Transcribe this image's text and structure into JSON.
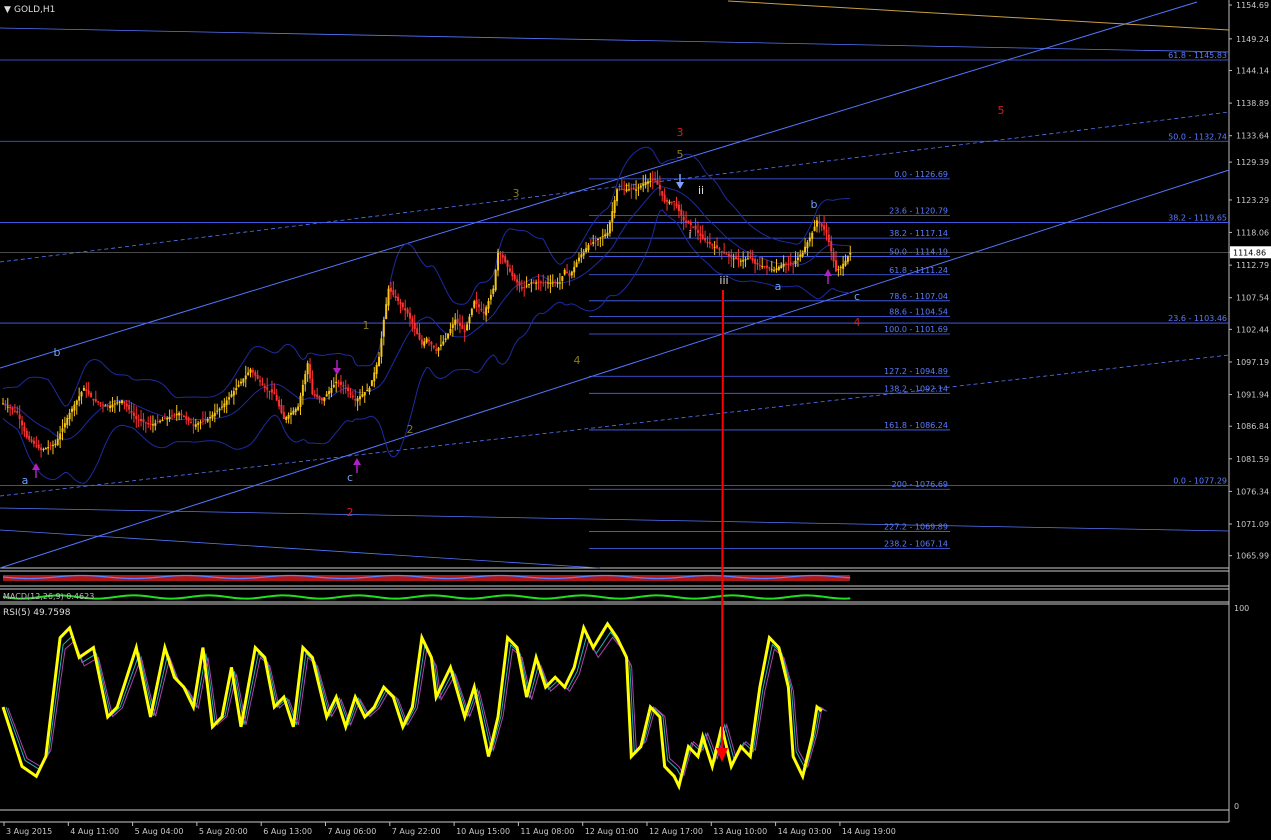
{
  "symbol_title": "GOLD,H1",
  "rsi_label": "RSI(5) 49.7598",
  "macd_label": "MACD(12,26,9) 0.4623",
  "colors": {
    "bull": "#f5c518",
    "bear": "#ff3030",
    "bands": "#1e2aa0",
    "fib": "#4a66ff",
    "channel": "#5577ff",
    "rsi": "#ffff00",
    "arrow": "#ff0000"
  },
  "chart_data": {
    "type": "candlestick",
    "ylim": [
      1064.0,
      1155.5
    ],
    "price_ticks": [
      "1154.69",
      "1149.24",
      "1144.14",
      "1138.89",
      "1133.64",
      "1129.39",
      "1123.29",
      "1118.06",
      "1114.86",
      "1112.79",
      "1107.54",
      "1102.44",
      "1097.19",
      "1091.94",
      "1086.84",
      "1081.59",
      "1076.34",
      "1071.09",
      "1065.99"
    ],
    "current_price": "1114.86",
    "time_labels": [
      "3 Aug 2015",
      "4 Aug 11:00",
      "5 Aug 04:00",
      "5 Aug 20:00",
      "6 Aug 13:00",
      "7 Aug 06:00",
      "7 Aug 22:00",
      "10 Aug 15:00",
      "11 Aug 08:00",
      "12 Aug 01:00",
      "12 Aug 17:00",
      "13 Aug 10:00",
      "14 Aug 03:00",
      "14 Aug 19:00"
    ],
    "close_path": [
      [
        0,
        1090.5
      ],
      [
        6,
        1089
      ],
      [
        10,
        1085
      ],
      [
        16,
        1083
      ],
      [
        22,
        1084
      ],
      [
        28,
        1089
      ],
      [
        34,
        1093
      ],
      [
        38,
        1091
      ],
      [
        44,
        1090
      ],
      [
        50,
        1091
      ],
      [
        56,
        1088
      ],
      [
        62,
        1087
      ],
      [
        68,
        1088
      ],
      [
        74,
        1089
      ],
      [
        80,
        1087
      ],
      [
        86,
        1088
      ],
      [
        92,
        1090
      ],
      [
        98,
        1093
      ],
      [
        104,
        1096
      ],
      [
        110,
        1093
      ],
      [
        114,
        1092
      ],
      [
        118,
        1088
      ],
      [
        124,
        1090
      ],
      [
        128,
        1097
      ],
      [
        130,
        1092
      ],
      [
        134,
        1091
      ],
      [
        140,
        1094
      ],
      [
        144,
        1093
      ],
      [
        148,
        1091
      ],
      [
        154,
        1093
      ],
      [
        158,
        1098
      ],
      [
        160,
        1104
      ],
      [
        162,
        1109
      ],
      [
        166,
        1107
      ],
      [
        170,
        1105
      ],
      [
        176,
        1100
      ],
      [
        178,
        1101
      ],
      [
        182,
        1099
      ],
      [
        186,
        1101
      ],
      [
        190,
        1104
      ],
      [
        194,
        1102
      ],
      [
        198,
        1107
      ],
      [
        202,
        1105
      ],
      [
        206,
        1109
      ],
      [
        208,
        1115
      ],
      [
        210,
        1114
      ],
      [
        214,
        1111
      ],
      [
        218,
        1109
      ],
      [
        222,
        1110
      ],
      [
        226,
        1110
      ],
      [
        230,
        1110
      ],
      [
        234,
        1110
      ],
      [
        236,
        1112
      ],
      [
        238,
        1111
      ],
      [
        242,
        1114
      ],
      [
        246,
        1116
      ],
      [
        250,
        1117
      ],
      [
        254,
        1118
      ],
      [
        258,
        1125
      ],
      [
        262,
        1125
      ],
      [
        266,
        1125
      ],
      [
        270,
        1126.2
      ],
      [
        274,
        1126.5
      ],
      [
        276,
        1125
      ],
      [
        278,
        1123
      ],
      [
        282,
        1123
      ],
      [
        286,
        1120
      ],
      [
        290,
        1119
      ],
      [
        294,
        1117
      ],
      [
        298,
        1116
      ],
      [
        302,
        1115
      ],
      [
        306,
        1114
      ],
      [
        310,
        1113.5
      ],
      [
        314,
        1114
      ],
      [
        316,
        1113
      ],
      [
        320,
        1112.5
      ],
      [
        324,
        1112
      ],
      [
        328,
        1113
      ],
      [
        332,
        1113
      ],
      [
        336,
        1115
      ],
      [
        340,
        1118
      ],
      [
        342,
        1120
      ],
      [
        346,
        1118
      ],
      [
        348,
        1115
      ],
      [
        350,
        1111.8
      ],
      [
        352,
        1112.5
      ],
      [
        354,
        1113.5
      ],
      [
        356,
        1114.86
      ]
    ],
    "rsi_period": 5,
    "rsi_value": 49.7598,
    "rsi_ylim": [
      0,
      100
    ],
    "rsi_ticks": [
      "100",
      "0"
    ],
    "rsi_path": [
      [
        0,
        50
      ],
      [
        8,
        20
      ],
      [
        14,
        15
      ],
      [
        18,
        25
      ],
      [
        24,
        85
      ],
      [
        28,
        90
      ],
      [
        32,
        75
      ],
      [
        38,
        80
      ],
      [
        44,
        45
      ],
      [
        48,
        50
      ],
      [
        56,
        80
      ],
      [
        62,
        45
      ],
      [
        68,
        80
      ],
      [
        72,
        65
      ],
      [
        76,
        60
      ],
      [
        80,
        50
      ],
      [
        84,
        80
      ],
      [
        88,
        40
      ],
      [
        92,
        45
      ],
      [
        96,
        70
      ],
      [
        100,
        40
      ],
      [
        106,
        80
      ],
      [
        110,
        75
      ],
      [
        114,
        50
      ],
      [
        118,
        55
      ],
      [
        122,
        40
      ],
      [
        126,
        80
      ],
      [
        130,
        75
      ],
      [
        136,
        45
      ],
      [
        140,
        55
      ],
      [
        144,
        40
      ],
      [
        148,
        55
      ],
      [
        152,
        45
      ],
      [
        156,
        50
      ],
      [
        160,
        60
      ],
      [
        164,
        55
      ],
      [
        168,
        40
      ],
      [
        172,
        50
      ],
      [
        176,
        85
      ],
      [
        180,
        75
      ],
      [
        182,
        55
      ],
      [
        188,
        70
      ],
      [
        194,
        45
      ],
      [
        198,
        60
      ],
      [
        204,
        25
      ],
      [
        208,
        45
      ],
      [
        212,
        85
      ],
      [
        216,
        80
      ],
      [
        220,
        55
      ],
      [
        224,
        75
      ],
      [
        228,
        60
      ],
      [
        232,
        65
      ],
      [
        236,
        60
      ],
      [
        240,
        70
      ],
      [
        244,
        90
      ],
      [
        248,
        80
      ],
      [
        254,
        92
      ],
      [
        258,
        85
      ],
      [
        262,
        75
      ],
      [
        264,
        25
      ],
      [
        268,
        30
      ],
      [
        272,
        50
      ],
      [
        276,
        45
      ],
      [
        278,
        20
      ],
      [
        282,
        15
      ],
      [
        284,
        10
      ],
      [
        288,
        30
      ],
      [
        292,
        25
      ],
      [
        294,
        35
      ],
      [
        298,
        20
      ],
      [
        302,
        40
      ],
      [
        306,
        20
      ],
      [
        310,
        30
      ],
      [
        314,
        25
      ],
      [
        318,
        60
      ],
      [
        322,
        85
      ],
      [
        326,
        80
      ],
      [
        330,
        60
      ],
      [
        332,
        25
      ],
      [
        336,
        15
      ],
      [
        340,
        35
      ],
      [
        342,
        50
      ],
      [
        344,
        48
      ]
    ],
    "fib_levels": [
      {
        "label": "0.0 - 1126.69",
        "price": 1126.69
      },
      {
        "label": "23.6 - 1120.79",
        "price": 1120.79
      },
      {
        "label": "38.2 - 1117.14",
        "price": 1117.14
      },
      {
        "label": "50.0 - 1114.19",
        "price": 1114.19
      },
      {
        "label": "61.8 - 1111.24",
        "price": 1111.24
      },
      {
        "label": "78.6 - 1107.04",
        "price": 1107.04
      },
      {
        "label": "88.6 - 1104.54",
        "price": 1104.54
      },
      {
        "label": "100.0 - 1101.69",
        "price": 1101.69
      },
      {
        "label": "127.2 - 1094.89",
        "price": 1094.89
      },
      {
        "label": "138.2 - 1092.14",
        "price": 1092.14
      },
      {
        "label": "161.8 - 1086.24",
        "price": 1086.24
      },
      {
        "label": "200 - 1076.69",
        "price": 1076.69
      },
      {
        "label": "227.2 - 1069.89",
        "price": 1069.89
      },
      {
        "label": "238.2 - 1067.14",
        "price": 1067.14
      }
    ],
    "big_fib_levels": [
      {
        "label": "61.8 - 1145.83",
        "price": 1145.83
      },
      {
        "label": "50.0 - 1132.74",
        "price": 1132.74
      },
      {
        "label": "38.2 - 1119.65",
        "price": 1119.65
      },
      {
        "label": "23.6 - 1103.46",
        "price": 1103.46
      },
      {
        "label": "0.0 - 1077.29",
        "price": 1077.29
      }
    ],
    "wave_labels": [
      {
        "t": "a",
        "color": "#6aa0ff"
      },
      {
        "t": "b",
        "color": "#6aa0ff"
      },
      {
        "t": "c",
        "color": "#6aa0ff"
      },
      {
        "t": "1",
        "color": "#8a7a20"
      },
      {
        "t": "2",
        "color": "#8a7a20"
      },
      {
        "t": "2",
        "color": "#d02020"
      },
      {
        "t": "3",
        "color": "#8a7a20"
      },
      {
        "t": "4",
        "color": "#8a7a20"
      },
      {
        "t": "5",
        "color": "#8a7a20"
      },
      {
        "t": "3",
        "color": "#d02020"
      },
      {
        "t": "i",
        "color": "#e0e0e0"
      },
      {
        "t": "ii",
        "color": "#e0e0e0"
      },
      {
        "t": "iii",
        "color": "#e0e0e0"
      },
      {
        "t": "a",
        "color": "#6aa0ff"
      },
      {
        "t": "b",
        "color": "#6aa0ff"
      },
      {
        "t": "c",
        "color": "#6aa0ff"
      },
      {
        "t": "4",
        "color": "#d02020"
      },
      {
        "t": "5",
        "color": "#d02020"
      }
    ]
  }
}
